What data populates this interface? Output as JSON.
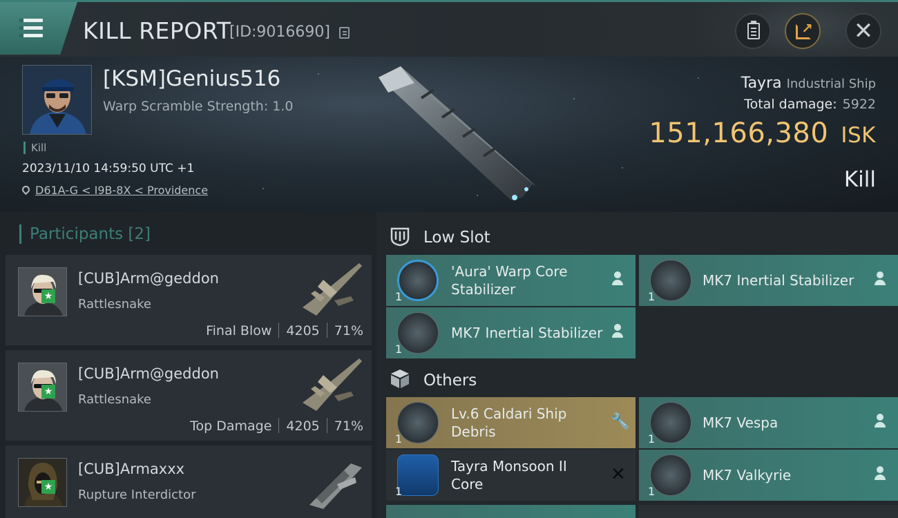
{
  "header": {
    "title": "KILL REPORT",
    "report_id": "[ID:9016690]"
  },
  "victim": {
    "name": "[KSM]Genius516",
    "scramble": "Warp Scramble Strength: 1.0",
    "tag": "Kill",
    "timestamp": "2023/11/10 14:59:50 UTC +1",
    "location": "D61A-G < I9B-8X < Providence",
    "ship_name": "Tayra",
    "ship_class": "Industrial Ship",
    "damage_label": "Total damage:",
    "damage_value": "5922",
    "isk_value": "151,166,380",
    "isk_unit": "ISK",
    "result": "Kill"
  },
  "participants": {
    "heading": "Participants",
    "count": "[2]",
    "list": [
      {
        "name": "[CUB]Arm@geddon",
        "ship": "Rattlesnake",
        "role": "Final Blow",
        "damage": "4205",
        "percent": "71%"
      },
      {
        "name": "[CUB]Arm@geddon",
        "ship": "Rattlesnake",
        "role": "Top Damage",
        "damage": "4205",
        "percent": "71%"
      },
      {
        "name": "[CUB]Armaxxx",
        "ship": "Rupture Interdictor"
      }
    ]
  },
  "sections": {
    "low_slot": "Low Slot",
    "others": "Others"
  },
  "low_slot_items": [
    {
      "line1": "'Aura' Warp Core",
      "line2": "Stabilizer",
      "qty": "1",
      "status": "dropped",
      "status_icon": "user-icon"
    },
    {
      "line1": "MK7 Inertial Stabilizer",
      "qty": "1",
      "status": "dropped",
      "status_icon": "user-icon"
    },
    {
      "line1": "MK7 Inertial Stabilizer",
      "qty": "1",
      "status": "dropped",
      "status_icon": "user-icon"
    }
  ],
  "other_items": [
    {
      "line1": "Lv.6 Caldari Ship",
      "line2": "Debris",
      "qty": "1",
      "status_icon": "wrench-icon"
    },
    {
      "line1": "MK7  Vespa",
      "qty": "1",
      "status_icon": "user-icon"
    },
    {
      "line1": "Tayra Monsoon II",
      "line2": "Core",
      "qty": "1",
      "status_icon": "close-icon"
    },
    {
      "line1": "MK7  Valkyrie",
      "qty": "1",
      "status_icon": "user-icon"
    }
  ],
  "colors": {
    "accent_teal": "#3c7f78",
    "isk_gold": "#f1c471",
    "dropped_item": "#3b8078",
    "salvage_item": "#9c8a58"
  }
}
